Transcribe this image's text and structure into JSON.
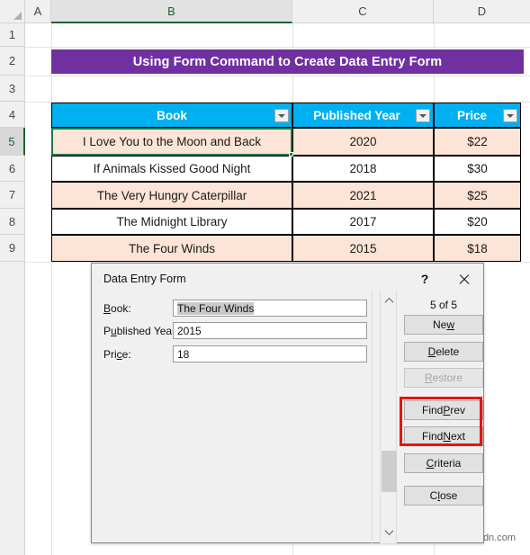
{
  "app": {
    "type": "spreadsheet",
    "watermark": "wsxdn.com"
  },
  "grid": {
    "column_headers": [
      "A",
      "B",
      "C",
      "D"
    ],
    "selected_column": "B",
    "row_headers": [
      "1",
      "2",
      "3",
      "4",
      "5",
      "6",
      "7",
      "8",
      "9"
    ],
    "selected_row": "5",
    "corner_icon": "select-all-triangle-icon"
  },
  "banner": {
    "text": "Using Form Command to Create Data Entry Form",
    "background": "#7030A0",
    "text_color": "#FFFFFF"
  },
  "table": {
    "header_background": "#00B0F0",
    "header_text_color": "#FFFFFF",
    "banded_row_color": "#FCE4D6",
    "alt_row_color": "#FFFFFF",
    "columns": [
      {
        "label": "Book",
        "filter_icon": "filter-dropdown-icon"
      },
      {
        "label": "Published Year",
        "filter_icon": "filter-dropdown-icon"
      },
      {
        "label": "Price",
        "filter_icon": "filter-dropdown-icon"
      }
    ],
    "rows": [
      {
        "book": "I Love You to the Moon and Back",
        "year": "2020",
        "price": "$22",
        "selected": true
      },
      {
        "book": "If Animals Kissed Good Night",
        "year": "2018",
        "price": "$30",
        "selected": false
      },
      {
        "book": "The Very Hungry Caterpillar",
        "year": "2021",
        "price": "$25",
        "selected": false
      },
      {
        "book": "The Midnight Library",
        "year": "2017",
        "price": "$20",
        "selected": false
      },
      {
        "book": "The Four Winds",
        "year": "2015",
        "price": "$18",
        "selected": false
      }
    ]
  },
  "dialog": {
    "title": "Data Entry Form",
    "help_label": "?",
    "close_label": "close-icon",
    "record_counter": "5 of 5",
    "fields": [
      {
        "label_pre": "",
        "label_acc": "B",
        "label_post": "ook:",
        "value": "The Four Winds",
        "highlighted": true
      },
      {
        "label_pre": "P",
        "label_acc": "u",
        "label_post": "blished Year:",
        "value": "2015",
        "highlighted": false
      },
      {
        "label_pre": "Pri",
        "label_acc": "c",
        "label_post": "e:",
        "value": "18",
        "highlighted": false
      }
    ],
    "buttons": [
      {
        "pre": "Ne",
        "acc": "w",
        "post": "",
        "disabled": false,
        "highlighted": false
      },
      {
        "pre": "",
        "acc": "D",
        "post": "elete",
        "disabled": false,
        "highlighted": false
      },
      {
        "pre": "",
        "acc": "R",
        "post": "estore",
        "disabled": true,
        "highlighted": false
      },
      {
        "pre": "Find ",
        "acc": "P",
        "post": "rev",
        "disabled": false,
        "highlighted": true
      },
      {
        "pre": "Find ",
        "acc": "N",
        "post": "ext",
        "disabled": false,
        "highlighted": true
      },
      {
        "pre": "",
        "acc": "C",
        "post": "riteria",
        "disabled": false,
        "highlighted": false
      },
      {
        "pre": "C",
        "acc": "l",
        "post": "ose",
        "disabled": false,
        "highlighted": false
      }
    ],
    "scrollbar": {
      "up_arrow": "chevron-up-icon",
      "down_arrow": "chevron-down-icon"
    },
    "annotation_color": "#E8130F"
  }
}
